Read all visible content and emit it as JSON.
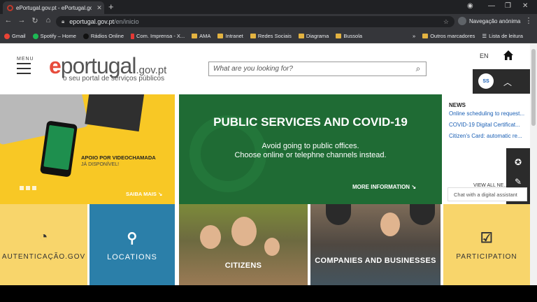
{
  "browser": {
    "tab_title": "ePortugal.gov.pt - ePortugal.gov",
    "tab_close": "✕",
    "new_tab": "+",
    "url_host": "eportugal.gov.pt",
    "url_path": "/en/inicio",
    "incognito_label": "Navegação anónima",
    "bookmarks": [
      {
        "label": "Gmail",
        "icon": "gmail-icon",
        "color": "#ea4335"
      },
      {
        "label": "Spotify – Home",
        "icon": "spotify-icon",
        "color": "#1db954"
      },
      {
        "label": "Rádios Online",
        "icon": "radio-icon",
        "color": "#222222"
      },
      {
        "label": "Com. Imprensa - X...",
        "icon": "flag-icon",
        "color": "#e53935"
      },
      {
        "label": "AMA",
        "icon": "folder-icon",
        "color": "#e3b341"
      },
      {
        "label": "Intranet",
        "icon": "folder-icon",
        "color": "#e3b341"
      },
      {
        "label": "Redes Sociais",
        "icon": "folder-icon",
        "color": "#e3b341"
      },
      {
        "label": "Diagrama",
        "icon": "folder-icon",
        "color": "#e3b341"
      },
      {
        "label": "Bussola",
        "icon": "folder-icon",
        "color": "#e3b341"
      }
    ],
    "bookmarks_overflow": "»",
    "other_bookmarks": "Outros marcadores",
    "reading_list": "Lista de leitura"
  },
  "header": {
    "menu_label": "MENU",
    "logo_e": "e",
    "logo_main": "portugal",
    "logo_gov": ".gov.pt",
    "tagline": "o seu portal de serviços públicos",
    "search_placeholder": "What are you looking for?",
    "lang": "EN",
    "avatar_initials": "SS"
  },
  "carousel": {
    "title": "APOIO POR VIDEOCHAMADA",
    "subtitle": "JÁ DISPONÍVEL!",
    "link": "SAIBA MAIS"
  },
  "covid": {
    "title": "PUBLIC SERVICES AND COVID-19",
    "line1": "Avoid going to public offices.",
    "line2": "Choose online or telephne channels instead.",
    "link": "MORE INFORMATION"
  },
  "news": {
    "heading": "NEWS",
    "items": [
      "Online scheduling to request...",
      "COVID-19 Digital Certificat...",
      "Citizen's Card: automatic re..."
    ],
    "view_all": "VIEW ALL NE..."
  },
  "assistant": {
    "tooltip": "Chat with a digital assistant"
  },
  "tiles": [
    {
      "label": "AUTENTICAÇÃO.GOV"
    },
    {
      "label": "LOCATIONS"
    },
    {
      "label": "CITIZENS"
    },
    {
      "label": "COMPANIES AND BUSINESSES"
    },
    {
      "label": "PARTICIPATION"
    }
  ],
  "colors": {
    "brand_red": "#e74c3c",
    "covid_green": "#1f6b34",
    "carousel_yellow": "#f8c825",
    "tile_blue": "#2b7fa9",
    "tile_yellow": "#f8d56b"
  }
}
